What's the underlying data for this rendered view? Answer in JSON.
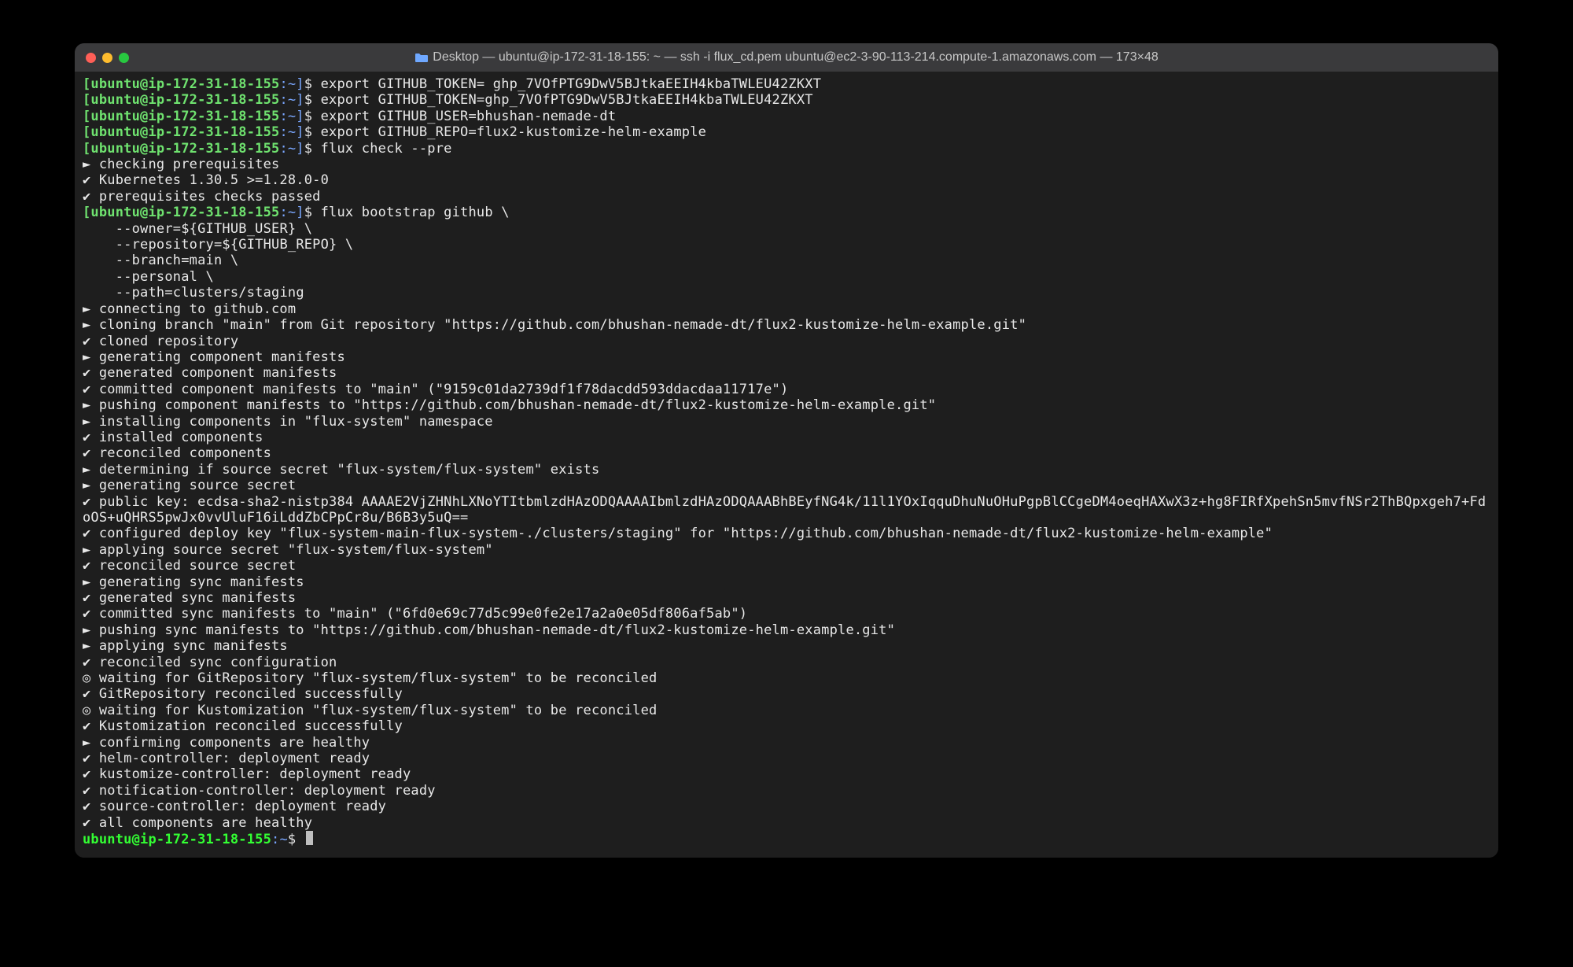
{
  "window": {
    "title": "Desktop — ubuntu@ip-172-31-18-155: ~ — ssh -i flux_cd.pem ubuntu@ec2-3-90-113-214.compute-1.amazonaws.com — 173×48"
  },
  "prompt": {
    "user_host": "ubuntu@ip-172-31-18-155",
    "path": "~",
    "sep": ":",
    "dollar": "$"
  },
  "commands": [
    "export GITHUB_TOKEN= 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",
    "export GITHUB_TOKEN=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",
    "export GITHUB_USER=bhushan-nemade-dt",
    "export GITHUB_REPO=flux2-kustomize-helm-example",
    "flux check --pre"
  ],
  "check_output": [
    "► checking prerequisites",
    "✔ Kubernetes 1.30.5 >=1.28.0-0",
    "✔ prerequisites checks passed"
  ],
  "bootstrap_cmd": [
    "flux bootstrap github \\",
    "    --owner=${GITHUB_USER} \\",
    "    --repository=${GITHUB_REPO} \\",
    "    --branch=main \\",
    "    --personal \\",
    "    --path=clusters/staging"
  ],
  "bootstrap_output": [
    "► connecting to github.com",
    "► cloning branch \"main\" from Git repository \"https://github.com/bhushan-nemade-dt/flux2-kustomize-helm-example.git\"",
    "✔ cloned repository",
    "► generating component manifests",
    "✔ generated component manifests",
    "✔ committed component manifests to \"main\" (\"9159c01da2739df1f78dacdd593ddacdaa11717e\")",
    "► pushing component manifests to \"https://github.com/bhushan-nemade-dt/flux2-kustomize-helm-example.git\"",
    "► installing components in \"flux-system\" namespace",
    "✔ installed components",
    "✔ reconciled components",
    "► determining if source secret \"flux-system/flux-system\" exists",
    "► generating source secret",
    "✔ public key: ecdsa-sha2-nistp384 AAAAE2VjZHNhLXNoYTItbmlzdHAzODQAAAAIbmlzdHAzODQAAABhBEyfNG4k/11l1YOxIqquDhuNuOHuPgpBlCCgeDM4oeqHAXwX3z+hg8FIRfXpehSn5mvfNSr2ThBQpxgeh7+FdoOS+uQHRS5pwJx0vvUluF16iLddZbCPpCr8u/B6B3y5uQ==",
    "✔ configured deploy key \"flux-system-main-flux-system-./clusters/staging\" for \"https://github.com/bhushan-nemade-dt/flux2-kustomize-helm-example\"",
    "► applying source secret \"flux-system/flux-system\"",
    "✔ reconciled source secret",
    "► generating sync manifests",
    "✔ generated sync manifests",
    "✔ committed sync manifests to \"main\" (\"6fd0e69c77d5c99e0fe2e17a2a0e05df806af5ab\")",
    "► pushing sync manifests to \"https://github.com/bhushan-nemade-dt/flux2-kustomize-helm-example.git\"",
    "► applying sync manifests",
    "✔ reconciled sync configuration",
    "◎ waiting for GitRepository \"flux-system/flux-system\" to be reconciled",
    "✔ GitRepository reconciled successfully",
    "◎ waiting for Kustomization \"flux-system/flux-system\" to be reconciled",
    "✔ Kustomization reconciled successfully",
    "► confirming components are healthy",
    "✔ helm-controller: deployment ready",
    "✔ kustomize-controller: deployment ready",
    "✔ notification-controller: deployment ready",
    "✔ source-controller: deployment ready",
    "✔ all components are healthy"
  ]
}
